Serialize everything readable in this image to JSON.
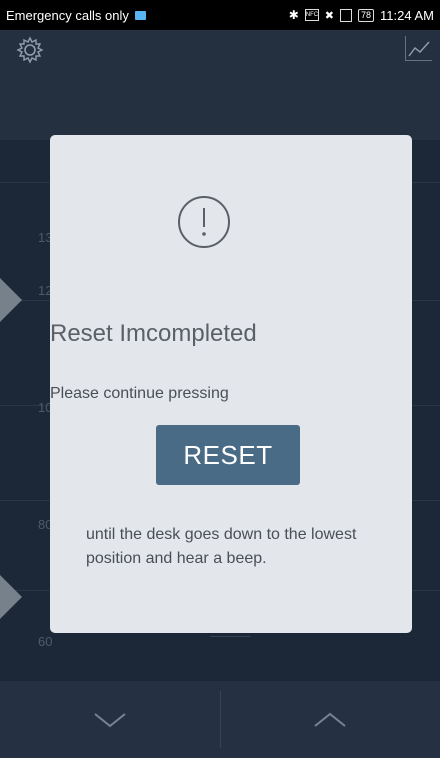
{
  "status": {
    "carrier": "Emergency calls only",
    "battery": "78",
    "time": "11:24 AM"
  },
  "scale": {
    "labels": [
      "13",
      "12",
      "10",
      "80",
      "60"
    ]
  },
  "modal": {
    "title": "Reset Imcompleted",
    "instruction": "Please continue pressing",
    "button_label": "RESET",
    "detail": "until the desk goes down to the lowest position and hear a beep."
  },
  "icons": {
    "settings": "gear-icon",
    "chart": "line-chart-icon",
    "alert": "exclamation-circle-icon",
    "down": "chevron-down-icon",
    "up": "chevron-up-icon"
  },
  "colors": {
    "accent": "#4a6b86",
    "background": "#1e2a3a",
    "modal": "#e3e6ea"
  }
}
